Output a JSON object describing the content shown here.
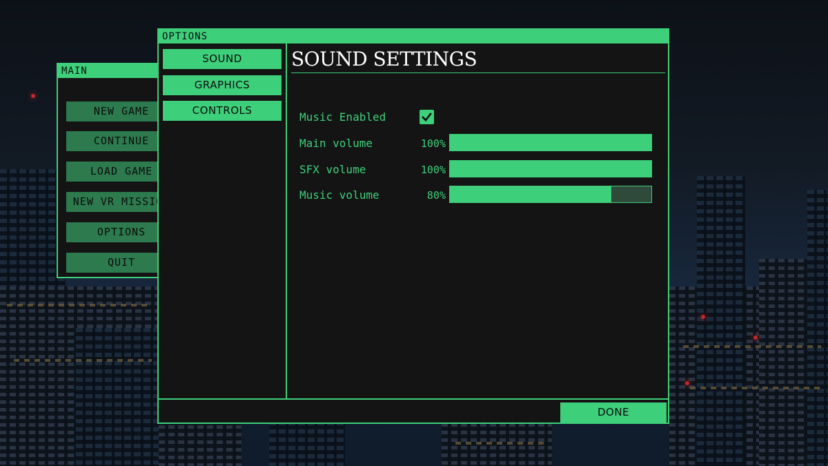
{
  "main_window": {
    "title": "MAIN",
    "buttons": [
      "NEW GAME",
      "CONTINUE",
      "LOAD GAME",
      "NEW VR MISSION",
      "OPTIONS",
      "QUIT"
    ]
  },
  "options_window": {
    "title": "OPTIONS",
    "tabs": [
      "SOUND",
      "GRAPHICS",
      "CONTROLS"
    ],
    "active_tab": "SOUND",
    "heading": "SOUND SETTINGS",
    "music_enabled": {
      "label": "Music Enabled",
      "checked": true
    },
    "sliders": [
      {
        "label": "Main volume",
        "value_text": "100%",
        "value": 100
      },
      {
        "label": "SFX volume",
        "value_text": "100%",
        "value": 100
      },
      {
        "label": "Music volume",
        "value_text": "80%",
        "value": 80
      }
    ],
    "done_label": "DONE"
  },
  "colors": {
    "accent": "#3ecf7a",
    "panel_bg": "#141414",
    "slider_track": "#2f4a3a",
    "main_button_bg": "#2c7a4d"
  },
  "icons": {
    "checkbox": "checkmark-icon"
  }
}
